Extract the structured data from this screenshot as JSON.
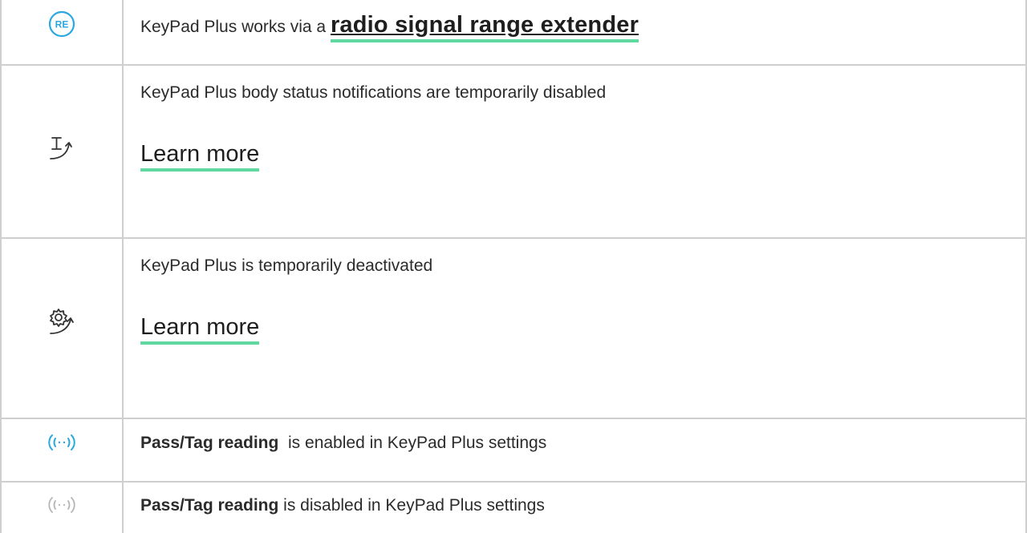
{
  "colors": {
    "accent": "#2aa8e0",
    "link_underline": "#5fd9a0",
    "border": "#cfcfcf",
    "icon_dark": "#333333",
    "icon_muted": "#b5b5b5"
  },
  "rows": [
    {
      "icon": "re-range-extender-icon",
      "text_prefix": "KeyPad Plus works via a ",
      "link": "radio signal range extender"
    },
    {
      "icon": "body-status-muted-icon",
      "text": "KeyPad Plus body status notifications are temporarily disabled",
      "link": "Learn more"
    },
    {
      "icon": "gear-deactivated-icon",
      "text": "KeyPad Plus is temporarily deactivated",
      "link": "Learn more"
    },
    {
      "icon": "pass-tag-enabled-icon",
      "bold": "Pass/Tag reading",
      "text": "  is enabled in KeyPad Plus settings"
    },
    {
      "icon": "pass-tag-disabled-icon",
      "bold": "Pass/Tag reading",
      "text": " is disabled in KeyPad Plus settings"
    }
  ],
  "re_icon_label": "RE"
}
